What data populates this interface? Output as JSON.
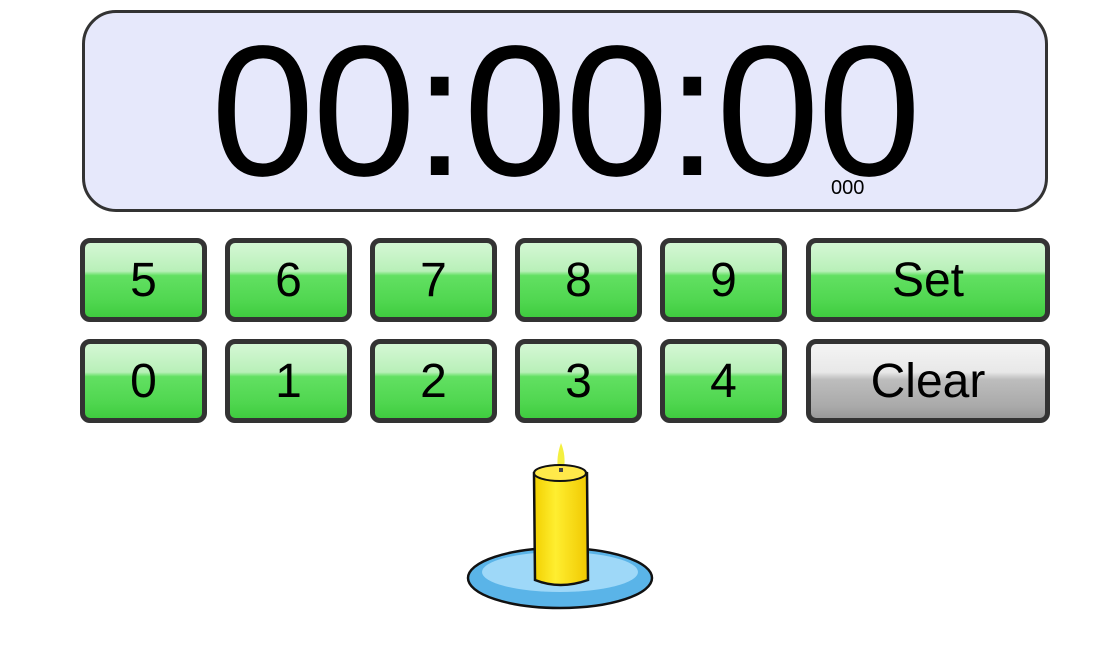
{
  "display": {
    "time": "00:00:00",
    "milliseconds": "000",
    "background": "#e6e8fb"
  },
  "keypad": {
    "row1": [
      "5",
      "6",
      "7",
      "8",
      "9"
    ],
    "row2": [
      "0",
      "1",
      "2",
      "3",
      "4"
    ],
    "set_label": "Set",
    "clear_label": "Clear",
    "digit_color": "#4fd64f",
    "clear_color": "#bdbdbd"
  },
  "illustration": {
    "icon": "candle-icon"
  }
}
